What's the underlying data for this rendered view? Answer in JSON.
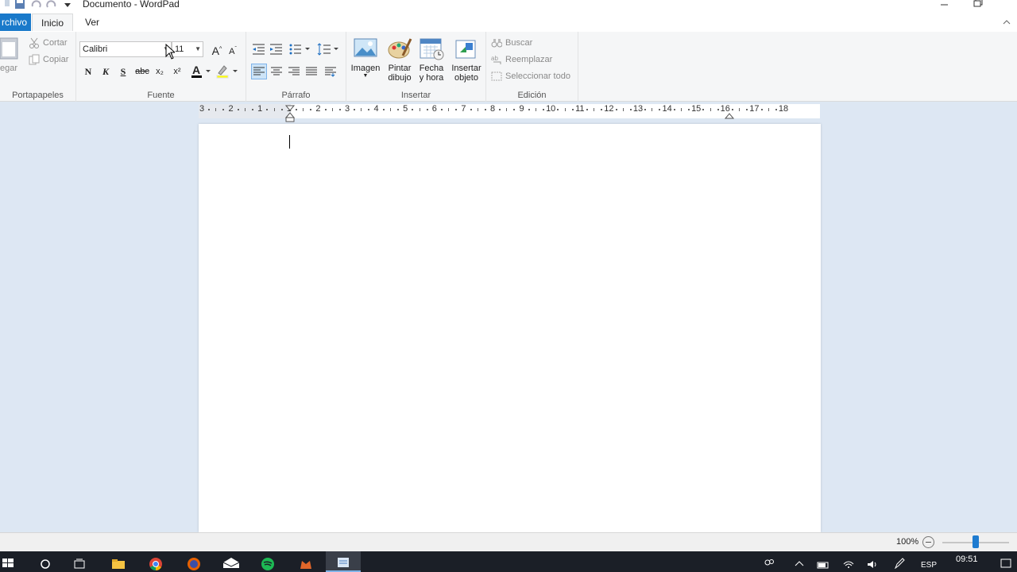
{
  "window": {
    "title": "Documento - WordPad"
  },
  "tabs": {
    "file": "rchivo",
    "home": "Inicio",
    "view": "Ver"
  },
  "clipboard": {
    "cut": "Cortar",
    "copy": "Copiar",
    "paste": "egar",
    "label": "Portapapeles"
  },
  "font": {
    "family": "Calibri",
    "size": "11",
    "label": "Fuente",
    "bold": "N",
    "italic": "K",
    "underline": "S",
    "strike": "abc",
    "subscript": "x₂",
    "superscript": "x²"
  },
  "paragraph": {
    "label": "Párrafo"
  },
  "insert": {
    "image": "Imagen",
    "paint_1": "Pintar",
    "paint_2": "dibujo",
    "datetime_1": "Fecha",
    "datetime_2": "y hora",
    "object_1": "Insertar",
    "object_2": "objeto",
    "label": "Insertar"
  },
  "editing": {
    "find": "Buscar",
    "replace": "Reemplazar",
    "select_all": "Seleccionar todo",
    "label": "Edición"
  },
  "ruler": {
    "numbers": [
      "3",
      "2",
      "1",
      "1",
      "2",
      "3",
      "4",
      "5",
      "6",
      "7",
      "8",
      "9",
      "10",
      "11",
      "12",
      "13",
      "14",
      "15",
      "16",
      "17",
      "18"
    ]
  },
  "status": {
    "zoom": "100%",
    "zoom_level": 0.5
  },
  "taskbar": {
    "time": "09:51",
    "lang": "ESP"
  },
  "colors": {
    "accent": "#1979ca",
    "font_color": "#000000",
    "highlight": "#ffff00"
  }
}
